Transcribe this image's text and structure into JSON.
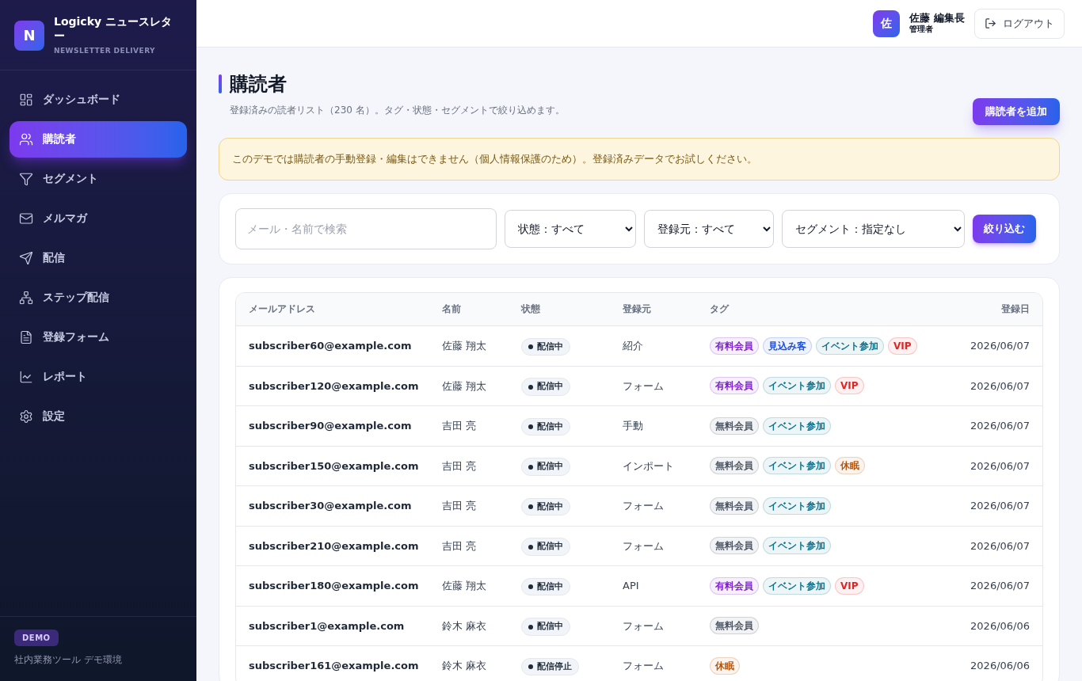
{
  "brand": {
    "logo_letter": "N",
    "title": "Logicky ニュースレター",
    "subtitle": "NEWSLETTER DELIVERY"
  },
  "sidebar": {
    "items": [
      {
        "label": "ダッシュボード",
        "selected": false
      },
      {
        "label": "購読者",
        "selected": true
      },
      {
        "label": "セグメント",
        "selected": false
      },
      {
        "label": "メルマガ",
        "selected": false
      },
      {
        "label": "配信",
        "selected": false
      },
      {
        "label": "ステップ配信",
        "selected": false
      },
      {
        "label": "登録フォーム",
        "selected": false
      },
      {
        "label": "レポート",
        "selected": false
      },
      {
        "label": "設定",
        "selected": false
      }
    ],
    "footer": {
      "badge": "DEMO",
      "note": "社内業務ツール デモ環境"
    }
  },
  "header": {
    "avatar": "佐",
    "user_name": "佐藤 編集長",
    "role": "管理者",
    "logout": "ログアウト"
  },
  "page": {
    "title": "購読者",
    "subtitle": "登録済みの読者リスト（230 名）。タグ・状態・セグメントで絞り込めます。",
    "add_button": "購読者を追加",
    "notice": "このデモでは購読者の手動登録・編集はできません（個人情報保護のため）。登録済みデータでお試しください。"
  },
  "filters": {
    "search": {
      "placeholder": "メール・名前で検索"
    },
    "selects": [
      {
        "value": "状態：すべて"
      },
      {
        "value": "登録元：すべて"
      },
      {
        "value": "セグメント：指定なし"
      }
    ],
    "apply": "絞り込む"
  },
  "table": {
    "columns": [
      "メールアドレス",
      "名前",
      "状態",
      "登録元",
      "タグ",
      "登録日"
    ],
    "rows": [
      {
        "email": "subscriber60@example.com",
        "name": "佐藤 翔太",
        "status": "配信中",
        "source": "紹介",
        "tags": [
          {
            "label": "有料会員",
            "color": "#7e22ce"
          },
          {
            "label": "見込み客",
            "color": "#1d4ed8"
          },
          {
            "label": "イベント参加",
            "color": "#0e7490"
          },
          {
            "label": "VIP",
            "color": "#dc2626"
          }
        ],
        "date": "2026/06/07"
      },
      {
        "email": "subscriber120@example.com",
        "name": "佐藤 翔太",
        "status": "配信中",
        "source": "フォーム",
        "tags": [
          {
            "label": "有料会員",
            "color": "#7e22ce"
          },
          {
            "label": "イベント参加",
            "color": "#0e7490"
          },
          {
            "label": "VIP",
            "color": "#dc2626"
          }
        ],
        "date": "2026/06/07"
      },
      {
        "email": "subscriber90@example.com",
        "name": "吉田 亮",
        "status": "配信中",
        "source": "手動",
        "tags": [
          {
            "label": "無料会員",
            "color": "#4b5563"
          },
          {
            "label": "イベント参加",
            "color": "#0e7490"
          }
        ],
        "date": "2026/06/07"
      },
      {
        "email": "subscriber150@example.com",
        "name": "吉田 亮",
        "status": "配信中",
        "source": "インポート",
        "tags": [
          {
            "label": "無料会員",
            "color": "#4b5563"
          },
          {
            "label": "イベント参加",
            "color": "#0e7490"
          },
          {
            "label": "休眠",
            "color": "#b45309"
          }
        ],
        "date": "2026/06/07"
      },
      {
        "email": "subscriber30@example.com",
        "name": "吉田 亮",
        "status": "配信中",
        "source": "フォーム",
        "tags": [
          {
            "label": "無料会員",
            "color": "#4b5563"
          },
          {
            "label": "イベント参加",
            "color": "#0e7490"
          }
        ],
        "date": "2026/06/07"
      },
      {
        "email": "subscriber210@example.com",
        "name": "吉田 亮",
        "status": "配信中",
        "source": "フォーム",
        "tags": [
          {
            "label": "無料会員",
            "color": "#4b5563"
          },
          {
            "label": "イベント参加",
            "color": "#0e7490"
          }
        ],
        "date": "2026/06/07"
      },
      {
        "email": "subscriber180@example.com",
        "name": "佐藤 翔太",
        "status": "配信中",
        "source": "API",
        "tags": [
          {
            "label": "有料会員",
            "color": "#7e22ce"
          },
          {
            "label": "イベント参加",
            "color": "#0e7490"
          },
          {
            "label": "VIP",
            "color": "#dc2626"
          }
        ],
        "date": "2026/06/07"
      },
      {
        "email": "subscriber1@example.com",
        "name": "鈴木 麻衣",
        "status": "配信中",
        "source": "フォーム",
        "tags": [
          {
            "label": "無料会員",
            "color": "#4b5563"
          }
        ],
        "date": "2026/06/06"
      },
      {
        "email": "subscriber161@example.com",
        "name": "鈴木 麻衣",
        "status": "配信停止",
        "source": "フォーム",
        "tags": [
          {
            "label": "休眠",
            "color": "#b45309"
          }
        ],
        "date": "2026/06/06"
      }
    ]
  }
}
